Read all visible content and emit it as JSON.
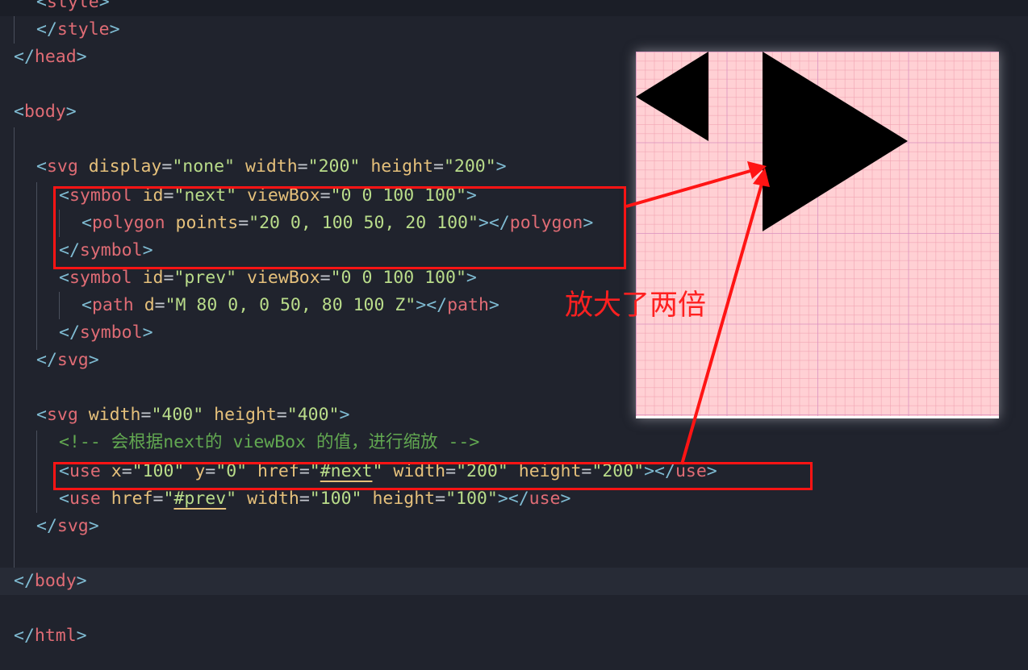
{
  "code": {
    "style_open_fragment": "style",
    "style_close": "style",
    "head_close": "head",
    "body_open": "body",
    "svg_hidden": {
      "tag": "svg",
      "attrs": [
        {
          "name": "display",
          "value": "\"none\""
        },
        {
          "name": "width",
          "value": "\"200\""
        },
        {
          "name": "height",
          "value": "\"200\""
        }
      ]
    },
    "symbol_next": {
      "tag": "symbol",
      "id_attr": "id",
      "id_value": "\"next\"",
      "viewbox_attr": "viewBox",
      "viewbox_value": "\"0 0 100 100\""
    },
    "polygon": {
      "tag": "polygon",
      "points_attr": "points",
      "points_value": "\"20 0, 100 50, 20 100\""
    },
    "symbol_close": "symbol",
    "symbol_prev": {
      "tag": "symbol",
      "id_attr": "id",
      "id_value": "\"prev\"",
      "viewbox_attr": "viewBox",
      "viewbox_value": "\"0 0 100 100\""
    },
    "path": {
      "tag": "path",
      "d_attr": "d",
      "d_value": "\"M 80 0, 0 50, 80 100 Z\""
    },
    "svg_close": "svg",
    "svg_visible": {
      "tag": "svg",
      "width_attr": "width",
      "width_value": "\"400\"",
      "height_attr": "height",
      "height_value": "\"400\""
    },
    "comment": "<!-- 会根据next的 viewBox 的值，进行缩放 -->",
    "use_next": {
      "tag": "use",
      "x_attr": "x",
      "x_value": "\"100\"",
      "y_attr": "y",
      "y_value": "\"0\"",
      "href_attr": "href",
      "href_q": "\"",
      "href_ref": "#next",
      "width_attr": "width",
      "width_value": "\"200\"",
      "height_attr": "height",
      "height_value": "\"200\""
    },
    "use_prev": {
      "tag": "use",
      "href_attr": "href",
      "href_q": "\"",
      "href_ref": "#prev",
      "width_attr": "width",
      "width_value": "\"100\"",
      "height_attr": "height",
      "height_value": "\"100\""
    },
    "body_close": "body",
    "html_close": "html"
  },
  "annotation": {
    "note": "放大了两倍",
    "color": "#ff1414"
  },
  "preview": {
    "grid_color": "#ffd0d4",
    "triangle_color": "#000000"
  }
}
